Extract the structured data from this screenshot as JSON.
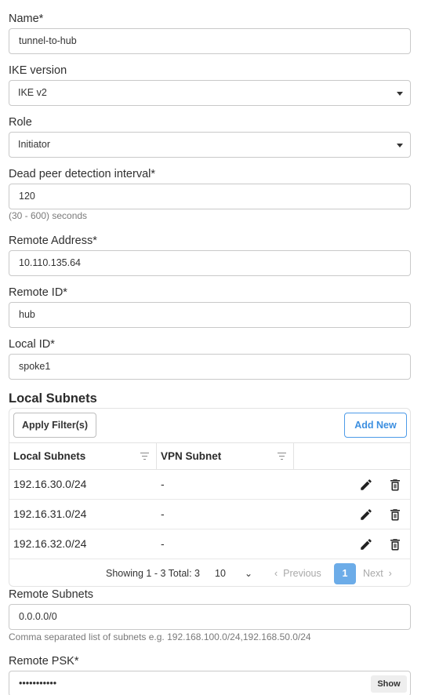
{
  "form": {
    "name": {
      "label": "Name*",
      "value": "tunnel-to-hub"
    },
    "ike_version": {
      "label": "IKE version",
      "value": "IKE v2"
    },
    "role": {
      "label": "Role",
      "value": "Initiator"
    },
    "dpd": {
      "label": "Dead peer detection interval*",
      "value": "120",
      "hint": "(30 - 600) seconds"
    },
    "remote_address": {
      "label": "Remote Address*",
      "value": "10.110.135.64"
    },
    "remote_id": {
      "label": "Remote ID*",
      "value": "hub"
    },
    "local_id": {
      "label": "Local ID*",
      "value": "spoke1"
    }
  },
  "local_subnets": {
    "title": "Local Subnets",
    "apply_filters_label": "Apply Filter(s)",
    "add_new_label": "Add New",
    "columns": [
      "Local Subnets",
      "VPN Subnet"
    ],
    "rows": [
      {
        "subnet": "192.16.30.0/24",
        "vpn": "-"
      },
      {
        "subnet": "192.16.31.0/24",
        "vpn": "-"
      },
      {
        "subnet": "192.16.32.0/24",
        "vpn": "-"
      }
    ],
    "pagination": {
      "showing": "Showing 1 - 3 Total: 3",
      "page_size": "10",
      "previous": "Previous",
      "current_page": "1",
      "next": "Next"
    }
  },
  "remote_subnets": {
    "label": "Remote Subnets",
    "value": "0.0.0.0/0",
    "hint": "Comma separated list of subnets e.g. 192.168.100.0/24,192.168.50.0/24"
  },
  "remote_psk": {
    "label": "Remote PSK*",
    "value": "•••••••••••",
    "show_label": "Show"
  },
  "icons": {
    "edit": "pencil-icon",
    "delete": "trash-icon",
    "select": "caret-down-icon",
    "filter": "filter-icon"
  },
  "colors": {
    "accent": "#3d8fe0",
    "active_page": "#6cace8"
  }
}
